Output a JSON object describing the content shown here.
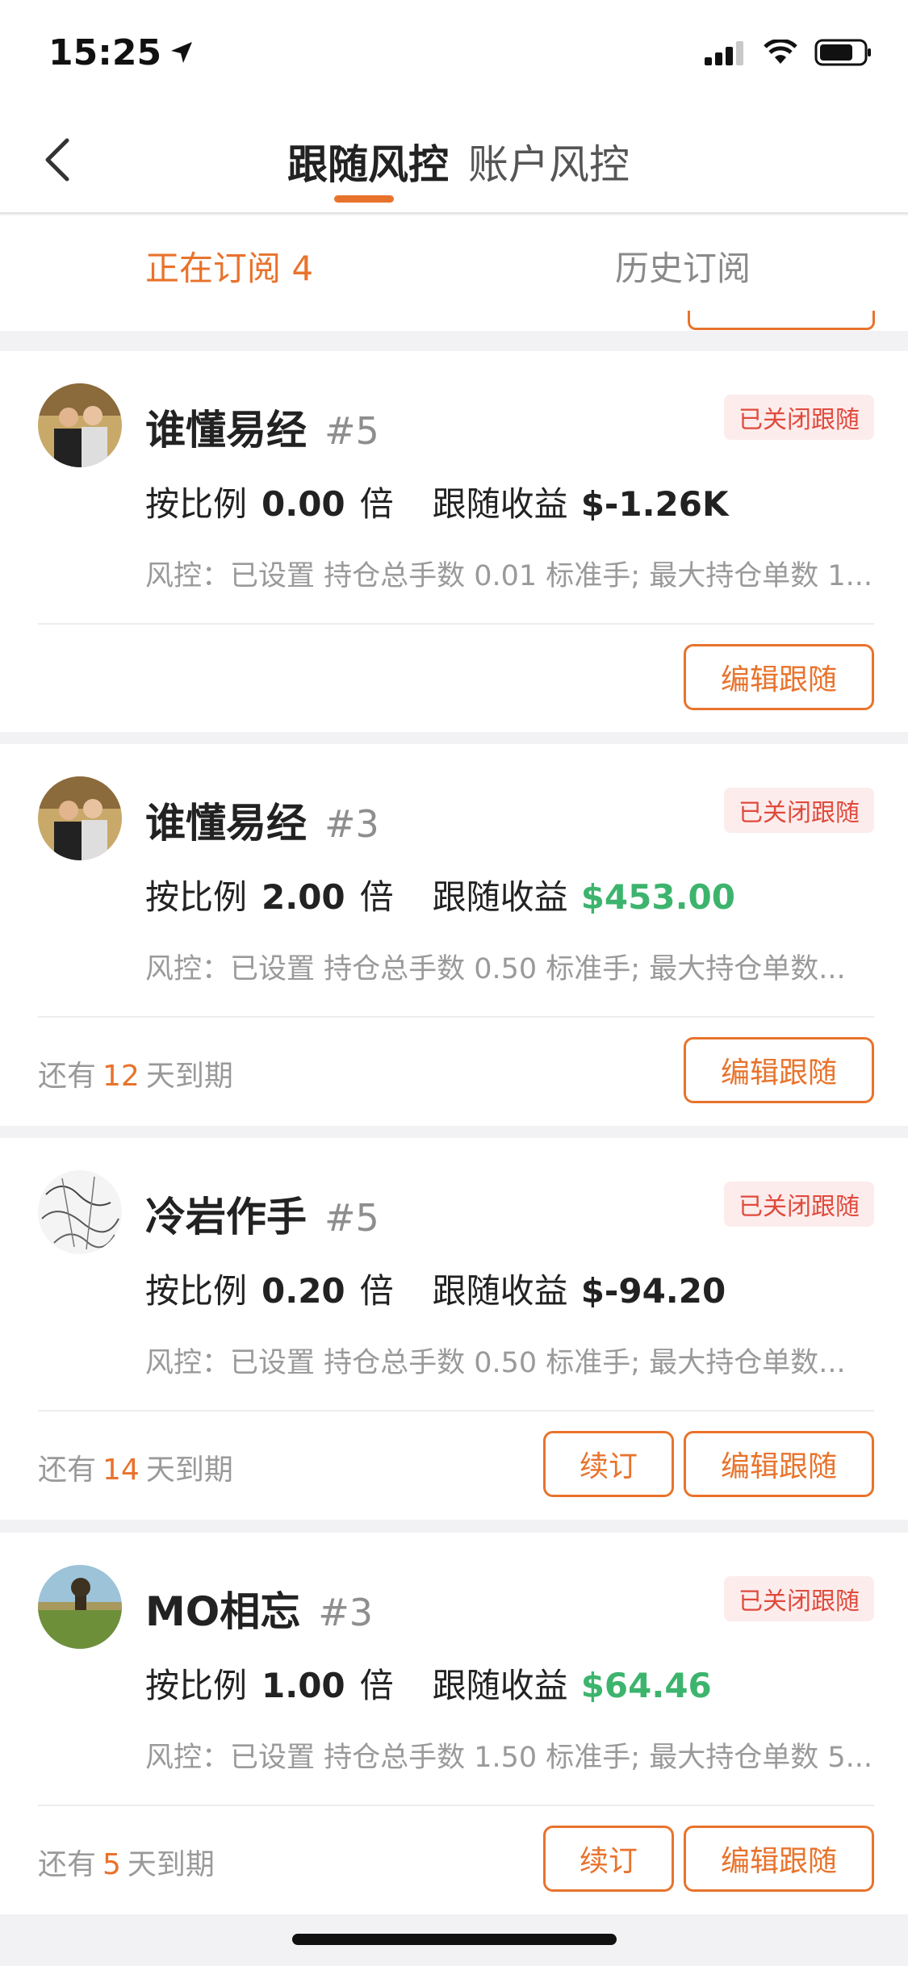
{
  "status_bar": {
    "time": "15:25"
  },
  "nav": {
    "tabs": [
      {
        "label": "跟随风控",
        "active": true
      },
      {
        "label": "账户风控",
        "active": false
      }
    ]
  },
  "subtabs": {
    "active_label": "正在订阅 4",
    "inactive_label": "历史订阅"
  },
  "cards": [
    {
      "name": "谁懂易经",
      "strategy": "#5",
      "badge": "已关闭跟随",
      "ratio_label": "按比例",
      "ratio_value": "0.00",
      "ratio_unit": "倍",
      "profit_label": "跟随收益",
      "profit_value": "$-1.26K",
      "risk": "风控：已设置 持仓总手数 0.01 标准手; 最大持仓单数 1...",
      "edit_label": "编辑跟随"
    },
    {
      "name": "谁懂易经",
      "strategy": "#3",
      "badge": "已关闭跟随",
      "ratio_label": "按比例",
      "ratio_value": "2.00",
      "ratio_unit": "倍",
      "profit_label": "跟随收益",
      "profit_value": "$453.00",
      "risk": "风控：已设置 持仓总手数 0.50 标准手; 最大持仓单数...",
      "expiry_prefix": "还有",
      "expiry_days": "12",
      "expiry_suffix": "天到期",
      "edit_label": "编辑跟随"
    },
    {
      "name": "冷岩作手",
      "strategy": "#5",
      "badge": "已关闭跟随",
      "ratio_label": "按比例",
      "ratio_value": "0.20",
      "ratio_unit": "倍",
      "profit_label": "跟随收益",
      "profit_value": "$-94.20",
      "risk": "风控：已设置 持仓总手数 0.50 标准手; 最大持仓单数...",
      "expiry_prefix": "还有",
      "expiry_days": "14",
      "expiry_suffix": "天到期",
      "renew_label": "续订",
      "edit_label": "编辑跟随"
    },
    {
      "name": "MO相忘",
      "strategy": "#3",
      "badge": "已关闭跟随",
      "ratio_label": "按比例",
      "ratio_value": "1.00",
      "ratio_unit": "倍",
      "profit_label": "跟随收益",
      "profit_value": "$64.46",
      "risk": "风控：已设置 持仓总手数 1.50 标准手; 最大持仓单数 5...",
      "expiry_prefix": "还有",
      "expiry_days": "5",
      "expiry_suffix": "天到期",
      "renew_label": "续订",
      "edit_label": "编辑跟随"
    }
  ],
  "colors": {
    "accent": "#e8732c",
    "profit_positive": "#3db46d",
    "badge_text": "#e04a3c",
    "badge_bg": "#fdecec"
  }
}
